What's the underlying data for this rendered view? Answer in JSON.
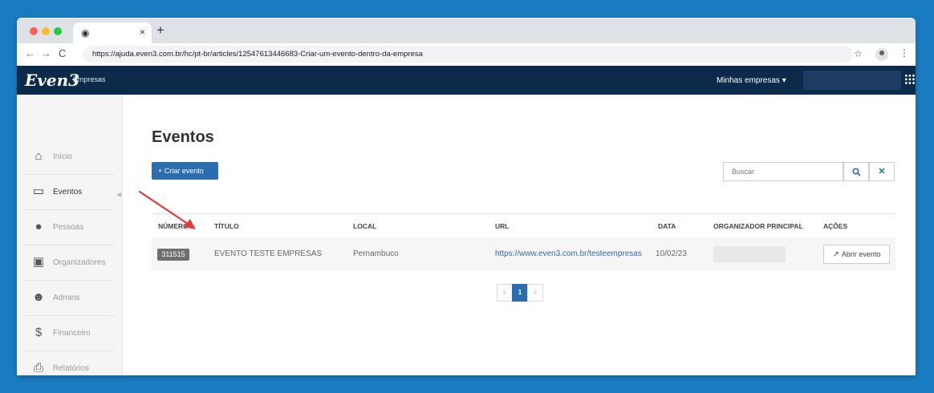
{
  "browser": {
    "url": "https://ajuda.even3.com.br/hc/pt-br/articles/12547613446683-Criar-um-evento-dentro-da-empresa",
    "tab_favicon": "chrome-icon",
    "tab_close": "×",
    "new_tab": "+",
    "back": "←",
    "forward": "→",
    "reload": "C",
    "star": "☆",
    "menu": "⋮"
  },
  "header": {
    "logo": "Even3",
    "logo_sub": "Empresas",
    "menu_label": "Minhas empresas ▾"
  },
  "sidebar": {
    "items": [
      {
        "label": "Início",
        "icon": "⌂"
      },
      {
        "label": "Eventos",
        "icon": "▭"
      },
      {
        "label": "Pessoas",
        "icon": "●"
      },
      {
        "label": "Organizadores",
        "icon": "▣"
      },
      {
        "label": "Admins",
        "icon": "☻"
      },
      {
        "label": "Financeiro",
        "icon": "$"
      },
      {
        "label": "Relatórios",
        "icon": "⎙"
      }
    ],
    "active": "Eventos",
    "collapse": "◀"
  },
  "main": {
    "title": "Eventos",
    "create_button": "+ Criar evento",
    "search_placeholder": "Buscar",
    "search_icon": "🔍",
    "clear_icon": "✕",
    "table": {
      "headers": [
        "Número",
        "Título",
        "Local",
        "URL",
        "Data",
        "Organizador principal",
        "Ações"
      ],
      "rows": [
        {
          "numero": "311515",
          "titulo": "EVENTO TESTE EMPRESAS",
          "local": "Pernambuco",
          "url": "https://www.even3.com.br/testeempresas",
          "data": "10/02/23",
          "acao": "Abrir evento"
        }
      ]
    },
    "pagination": {
      "prev": "«",
      "current": "1",
      "next": "»"
    }
  },
  "colors": {
    "page_bg": "#1a7cc0",
    "appbar": "#0c2a4a",
    "primary": "#2a6db0",
    "annotation_arrow": "#e53935"
  }
}
